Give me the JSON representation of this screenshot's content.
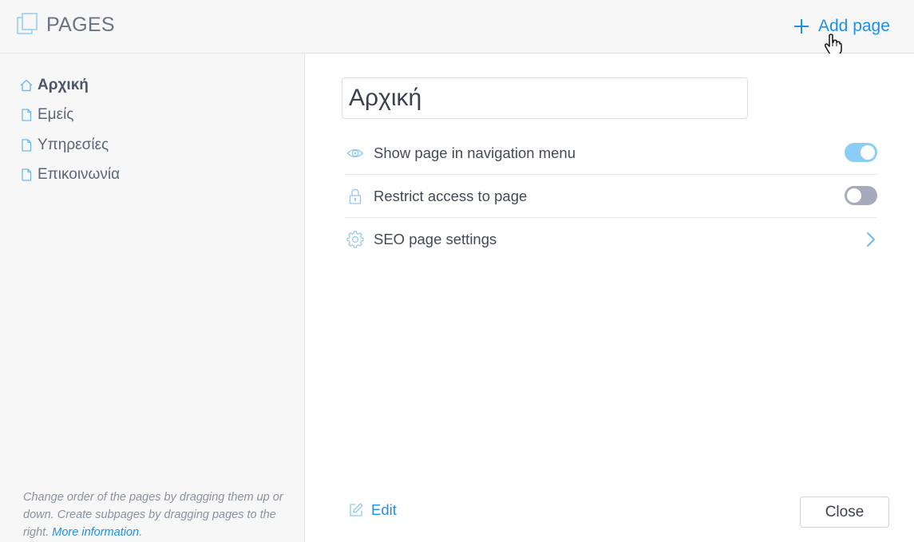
{
  "header": {
    "title": "PAGES",
    "add_page_label": "Add page"
  },
  "sidebar": {
    "items": [
      {
        "label": "Αρχική",
        "icon": "home-icon",
        "active": true
      },
      {
        "label": "Εμείς",
        "icon": "page-icon",
        "active": false
      },
      {
        "label": "Υπηρεσίες",
        "icon": "page-icon",
        "active": false
      },
      {
        "label": "Επικοινωνία",
        "icon": "page-icon",
        "active": false
      }
    ],
    "hint_text": "Change order of the pages by dragging them up or down. Create subpages by dragging pages to the right.",
    "hint_link": "More information",
    "hint_end": "."
  },
  "main": {
    "page_name_value": "Αρχική",
    "settings": [
      {
        "label": "Show page in navigation menu",
        "icon": "eye-icon",
        "control": "toggle",
        "state": "on"
      },
      {
        "label": "Restrict access to page",
        "icon": "lock-icon",
        "control": "toggle",
        "state": "off"
      },
      {
        "label": "SEO page settings",
        "icon": "gear-icon",
        "control": "chevron"
      }
    ],
    "edit_label": "Edit",
    "close_label": "Close"
  },
  "colors": {
    "accent": "#1e90e6",
    "toggle_on": "#8ccdf5",
    "toggle_off": "#a5abba",
    "sidebar_bg": "#f7f7f7"
  }
}
